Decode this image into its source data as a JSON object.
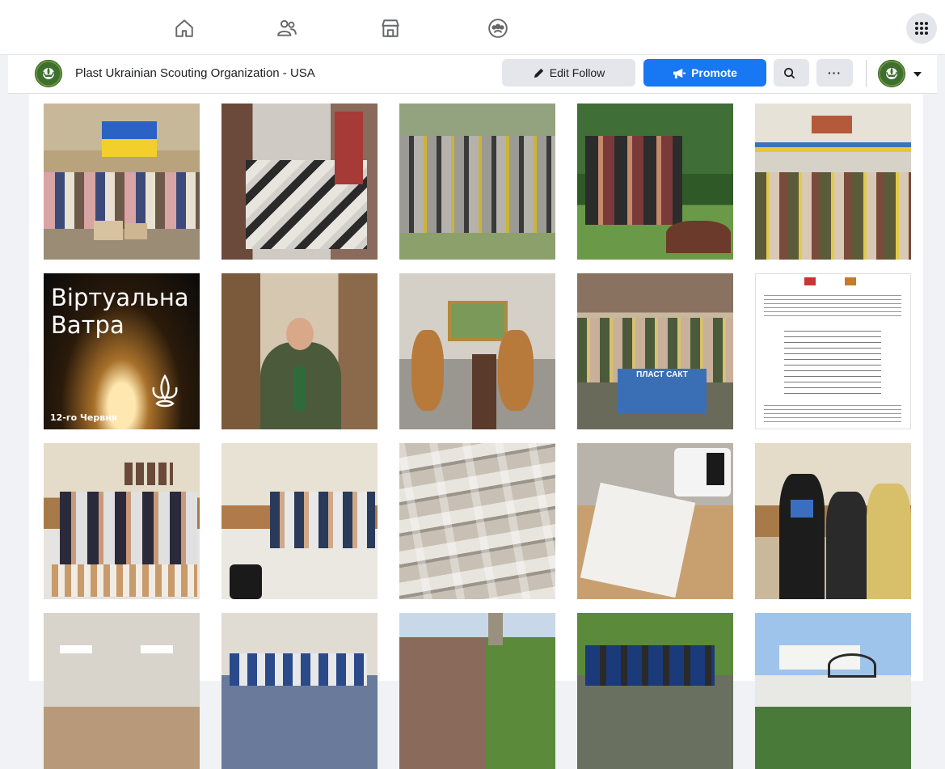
{
  "nav": {
    "icons": [
      "home-icon",
      "friends-icon",
      "marketplace-icon",
      "groups-icon",
      "menu-grid-icon"
    ]
  },
  "page": {
    "title": "Plast Ukrainian Scouting Organization - USA"
  },
  "actions": {
    "edit_follow_label": "Edit Follow",
    "promote_label": "Promote",
    "search_icon": "search-icon",
    "more_label": "···"
  },
  "colors": {
    "promote": "#1877f2",
    "button_gray": "#e4e6eb",
    "background": "#f0f2f5"
  },
  "photos": {
    "virtual_title_line1": "Віртуальна",
    "virtual_title_line2": "Ватра",
    "virtual_date": "12-го Червня",
    "banner_text": "ПЛАСТ САКТ"
  }
}
